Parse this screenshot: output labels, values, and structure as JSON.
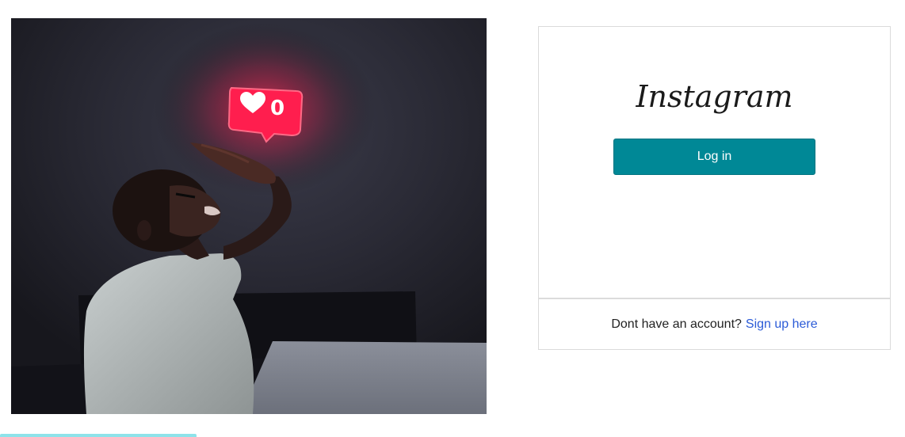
{
  "hero": {
    "like_count": "0",
    "heart_icon": "heart-icon"
  },
  "login": {
    "brand": "Instagram",
    "button_label": "Log in"
  },
  "signup": {
    "prompt": "Dont have an account?",
    "link_label": "Sign up here"
  },
  "colors": {
    "button": "#008896",
    "link": "#2b5bd7",
    "notification": "#ff1e4e",
    "accent_strip": "#8ee3ea"
  }
}
